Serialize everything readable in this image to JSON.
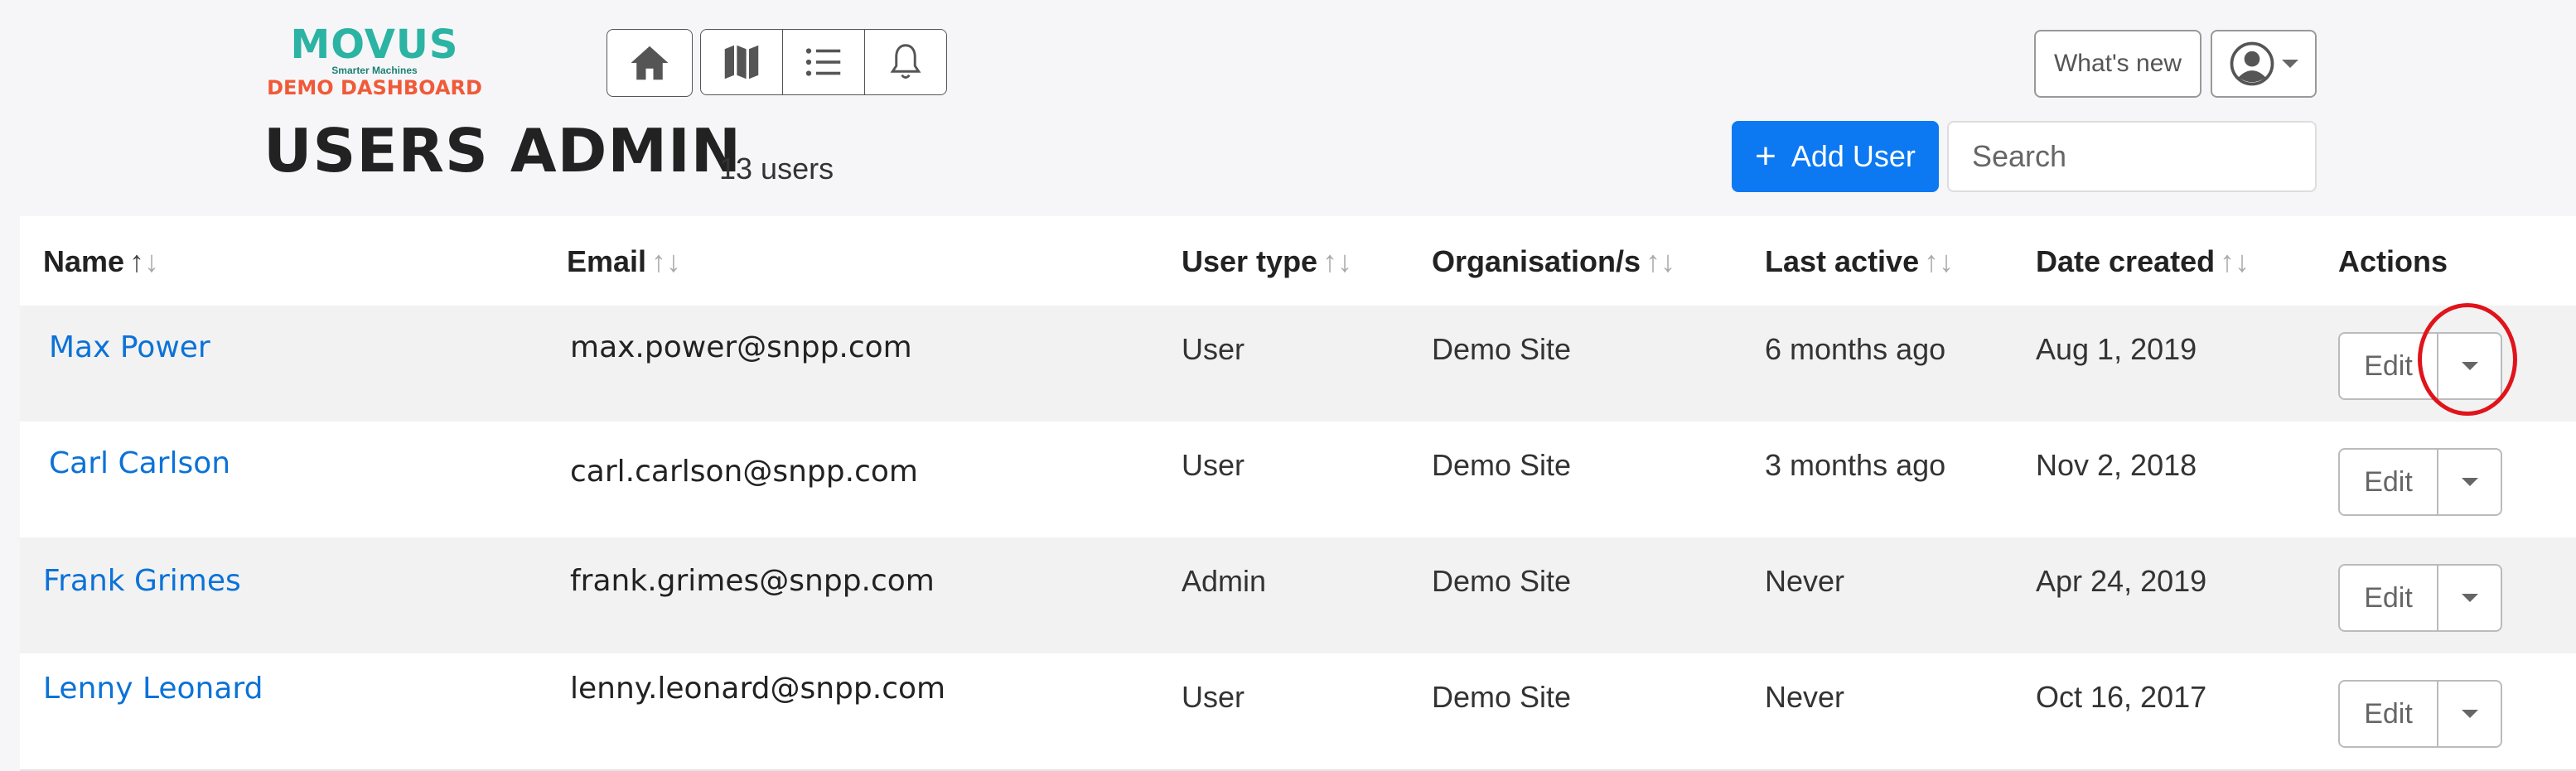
{
  "logo": {
    "brand": "MOVUS",
    "tagline": "Smarter Machines",
    "subtitle": "DEMO DASHBOARD"
  },
  "nav": {
    "icons": [
      "home-icon",
      "map-icon",
      "list-icon",
      "bell-icon"
    ]
  },
  "header": {
    "whats_new": "What's new",
    "title": "USERS ADMIN",
    "count": "13 users",
    "add_user": "Add User",
    "search_placeholder": "Search"
  },
  "table": {
    "columns": [
      "Name",
      "Email",
      "User type",
      "Organisation/s",
      "Last active",
      "Date created",
      "Actions"
    ],
    "rows": [
      {
        "name": "Max Power",
        "email": "max.power@snpp.com",
        "type": "User",
        "org": "Demo Site",
        "last_active": "6 months ago",
        "created": "Aug 1, 2019",
        "edit": "Edit"
      },
      {
        "name": "Carl Carlson",
        "email": "carl.carlson@snpp.com",
        "type": "User",
        "org": "Demo Site",
        "last_active": "3 months ago",
        "created": "Nov 2, 2018",
        "edit": "Edit"
      },
      {
        "name": "Frank Grimes",
        "email": "frank.grimes@snpp.com",
        "type": "Admin",
        "org": "Demo Site",
        "last_active": "Never",
        "created": "Apr 24, 2019",
        "edit": "Edit"
      },
      {
        "name": "Lenny Leonard",
        "email": "lenny.leonard@snpp.com",
        "type": "User",
        "org": "Demo Site",
        "last_active": "Never",
        "created": "Oct 16, 2017",
        "edit": "Edit"
      }
    ]
  },
  "colors": {
    "primary": "#0c79f2",
    "link": "#0b72d8",
    "brand_teal": "#2bb3a3",
    "brand_orange": "#f05a38",
    "highlight": "#e0141b"
  }
}
